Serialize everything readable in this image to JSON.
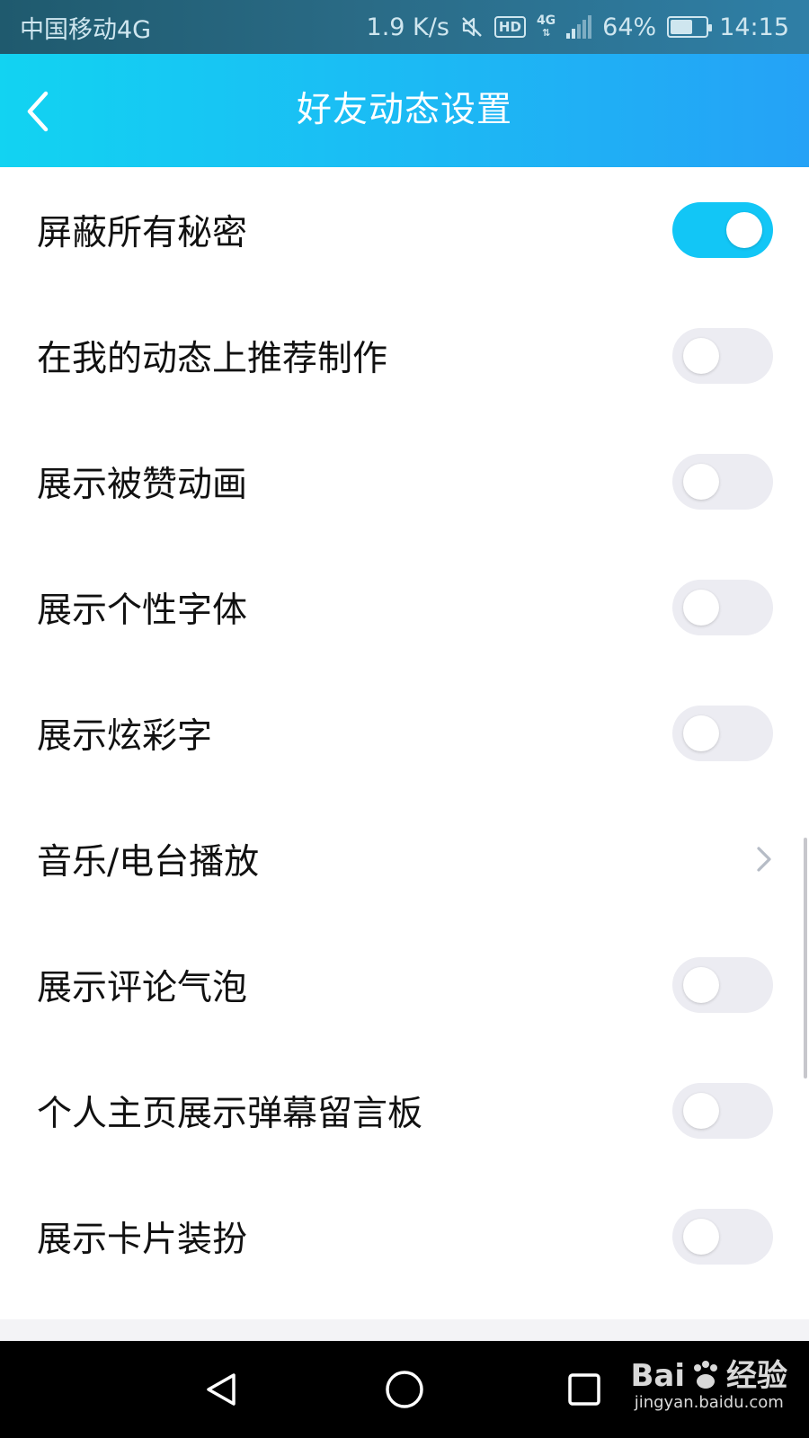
{
  "status_bar": {
    "carrier": "中国移动4G",
    "speed": "1.9 K/s",
    "hd_badge": "HD",
    "network": "4G",
    "battery": "64%",
    "battery_level": 0.64,
    "time": "14:15"
  },
  "header": {
    "title": "好友动态设置"
  },
  "settings": [
    {
      "label": "屏蔽所有秘密",
      "type": "toggle",
      "on": true
    },
    {
      "label": "在我的动态上推荐制作",
      "type": "toggle",
      "on": false
    },
    {
      "label": "展示被赞动画",
      "type": "toggle",
      "on": false
    },
    {
      "label": "展示个性字体",
      "type": "toggle",
      "on": false
    },
    {
      "label": "展示炫彩字",
      "type": "toggle",
      "on": false
    },
    {
      "label": "音乐/电台播放",
      "type": "link"
    },
    {
      "label": "展示评论气泡",
      "type": "toggle",
      "on": false
    },
    {
      "label": "个人主页展示弹幕留言板",
      "type": "toggle",
      "on": false
    },
    {
      "label": "展示卡片装扮",
      "type": "toggle",
      "on": false
    }
  ],
  "watermark": {
    "brand": "Bai",
    "brand_suffix": "经验",
    "url": "jingyan.baidu.com"
  },
  "colors": {
    "toggle_on": "#12c6f6",
    "toggle_off": "#ececf2",
    "header_start": "#12d3f2",
    "header_end": "#25a2f6"
  },
  "icons": {
    "back": "chevron-left-icon",
    "mute": "mute-icon",
    "link": "chevron-right-icon",
    "nav_back": "triangle-back-icon",
    "nav_home": "circle-home-icon",
    "nav_recent": "square-recents-icon",
    "watermark": "paw-icon"
  }
}
